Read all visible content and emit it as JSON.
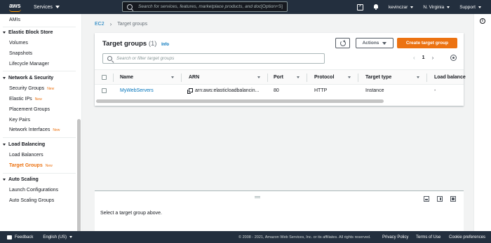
{
  "topnav": {
    "logo_text": "aws",
    "services_label": "Services",
    "search_placeholder": "Search for services, features, marketplace products, and docs",
    "search_shortcut": "[Option+S]",
    "user": "kevinczar",
    "region": "N. Virginia",
    "support": "Support"
  },
  "sidebar": {
    "top_item": "AMIs",
    "sections": [
      {
        "title": "Elastic Block Store",
        "items": [
          "Volumes",
          "Snapshots",
          "Lifecycle Manager"
        ]
      },
      {
        "title": "Network & Security",
        "items": [
          "Security Groups",
          "Elastic IPs",
          "Placement Groups",
          "Key Pairs",
          "Network Interfaces"
        ]
      },
      {
        "title": "Load Balancing",
        "items": [
          "Load Balancers",
          "Target Groups"
        ]
      },
      {
        "title": "Auto Scaling",
        "items": [
          "Launch Configurations",
          "Auto Scaling Groups"
        ]
      }
    ],
    "new_badge": "New",
    "active_item": "Target Groups"
  },
  "breadcrumb": {
    "parent": "EC2",
    "current": "Target groups"
  },
  "panel": {
    "title": "Target groups",
    "count": "(1)",
    "info": "Info",
    "actions_label": "Actions",
    "create_label": "Create target group",
    "filter_placeholder": "Search or filter target groups",
    "page": "1",
    "prev": "‹",
    "next": "›",
    "columns": [
      "Name",
      "ARN",
      "Port",
      "Protocol",
      "Target type",
      "Load balance"
    ],
    "rows": [
      {
        "name": "MyWebServers",
        "arn": "arn:aws:elasticloadbalancin...",
        "port": "80",
        "protocol": "HTTP",
        "target_type": "Instance",
        "load_balancer": "-"
      }
    ]
  },
  "split": {
    "message": "Select a target group above."
  },
  "rail": {
    "info_glyph": "i"
  },
  "footer": {
    "feedback": "Feedback",
    "language": "English (US)",
    "copyright": "© 2008 - 2021, Amazon Web Services, Inc. or its affiliates. All rights reserved.",
    "privacy": "Privacy Policy",
    "terms": "Terms of Use",
    "cookies": "Cookie preferences"
  },
  "colors": {
    "nav_bg": "#232f3e",
    "accent": "#ec7211",
    "link": "#0073bb"
  }
}
